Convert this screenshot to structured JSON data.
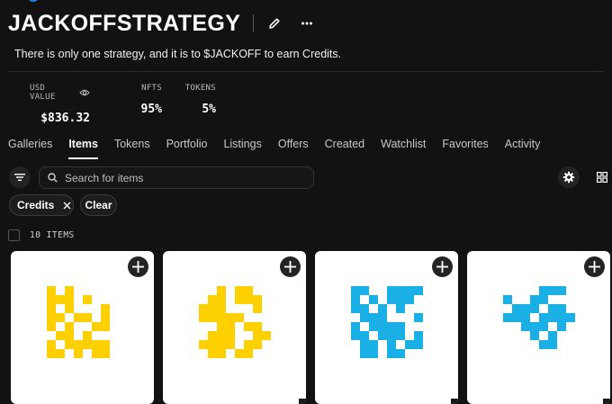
{
  "header": {
    "title": "JACKOFFSTRATEGY",
    "description": "There is only one strategy, and it is to $JACKOFF to earn Credits."
  },
  "stats": [
    {
      "label": "USD VALUE",
      "value": "$836.32"
    },
    {
      "label": "NFTS",
      "value": "95%"
    },
    {
      "label": "TOKENS",
      "value": "5%"
    }
  ],
  "tabs": [
    "Galleries",
    "Items",
    "Tokens",
    "Portfolio",
    "Listings",
    "Offers",
    "Created",
    "Watchlist",
    "Favorites",
    "Activity"
  ],
  "active_tab": "Items",
  "search": {
    "placeholder": "Search for items"
  },
  "chips": {
    "credits": "Credits",
    "clear": "Clear"
  },
  "items_count": "10 ITEMS",
  "colors": {
    "yellow": "#ffd000",
    "blue": "#1ab0e6",
    "accent": "#2081e2"
  },
  "icons": [
    "pencil-icon",
    "more-icon",
    "eye-icon",
    "filter-icon",
    "search-icon",
    "close-icon",
    "gear-icon",
    "grid-view-icon",
    "plus-icon"
  ]
}
